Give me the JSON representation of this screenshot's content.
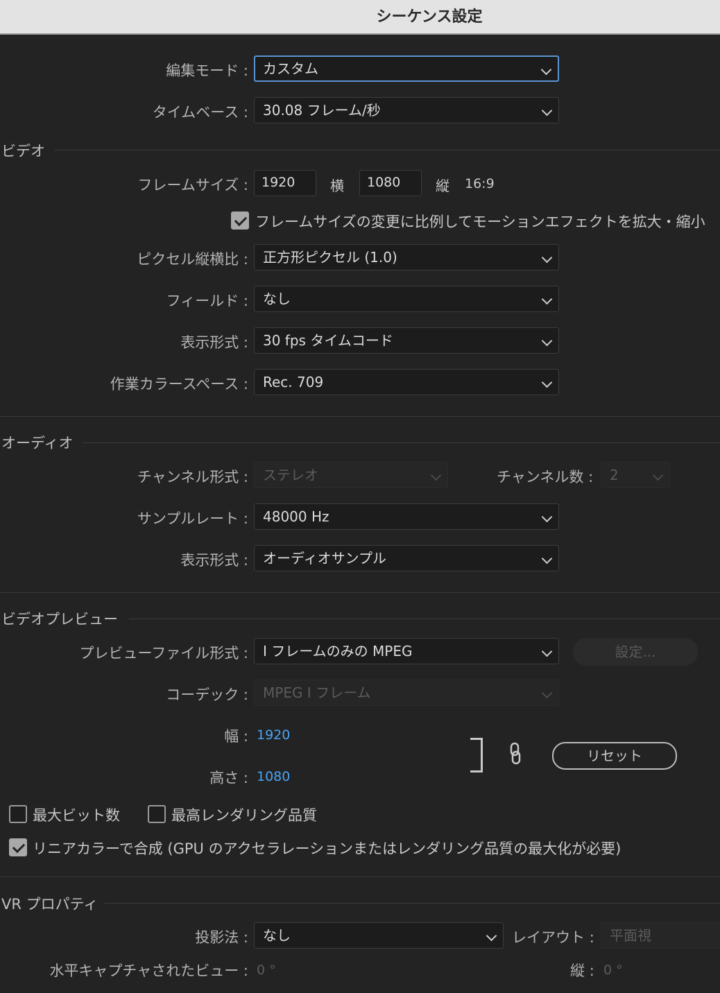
{
  "window": {
    "title": "シーケンス設定"
  },
  "colon": ":",
  "general": {
    "edit_mode_label": "編集モード",
    "edit_mode_value": "カスタム",
    "timebase_label": "タイムベース",
    "timebase_value": "30.08  フレーム/秒"
  },
  "video": {
    "section": "ビデオ",
    "frame_size_label": "フレームサイズ",
    "width": "1920",
    "width_unit": "横",
    "height": "1080",
    "height_unit": "縦",
    "aspect": "16:9",
    "scale_checkbox": "フレームサイズの変更に比例してモーションエフェクトを拡大・縮小",
    "scale_checked": true,
    "pixel_aspect_label": "ピクセル縦横比",
    "pixel_aspect_value": "正方形ピクセル (1.0)",
    "fields_label": "フィールド",
    "fields_value": "なし",
    "display_format_label": "表示形式",
    "display_format_value": "30 fps タイムコード",
    "color_space_label": "作業カラースペース",
    "color_space_value": "Rec. 709"
  },
  "audio": {
    "section": "オーディオ",
    "channel_format_label": "チャンネル形式",
    "channel_format_value": "ステレオ",
    "channel_count_label": "チャンネル数",
    "channel_count_value": "2",
    "sample_rate_label": "サンプルレート",
    "sample_rate_value": "48000 Hz",
    "display_format_label": "表示形式",
    "display_format_value": "オーディオサンプル"
  },
  "preview": {
    "section": "ビデオプレビュー",
    "file_format_label": "プレビューファイル形式",
    "file_format_value": "I フレームのみの MPEG",
    "settings_button": "設定...",
    "codec_label": "コーデック",
    "codec_value": "MPEG I フレーム",
    "width_label": "幅",
    "width_value": "1920",
    "height_label": "高さ",
    "height_value": "1080",
    "reset_button": "リセット",
    "max_bit_depth": "最大ビット数",
    "max_bit_depth_checked": false,
    "max_render_quality": "最高レンダリング品質",
    "max_render_quality_checked": false,
    "linear_color": "リニアカラーで合成 (GPU のアクセラレーションまたはレンダリング品質の最大化が必要)",
    "linear_color_checked": true
  },
  "vr": {
    "section": "VR プロパティ",
    "projection_label": "投影法",
    "projection_value": "なし",
    "layout_label": "レイアウト",
    "layout_value": "平面視",
    "horizontal_label": "水平キャプチャされたビュー",
    "horizontal_value": "0 °",
    "vertical_label": "縦",
    "vertical_value": "0 °"
  },
  "colors": {
    "accent": "#5a94d6",
    "link_value": "#4aa3f5",
    "background": "#232323"
  }
}
